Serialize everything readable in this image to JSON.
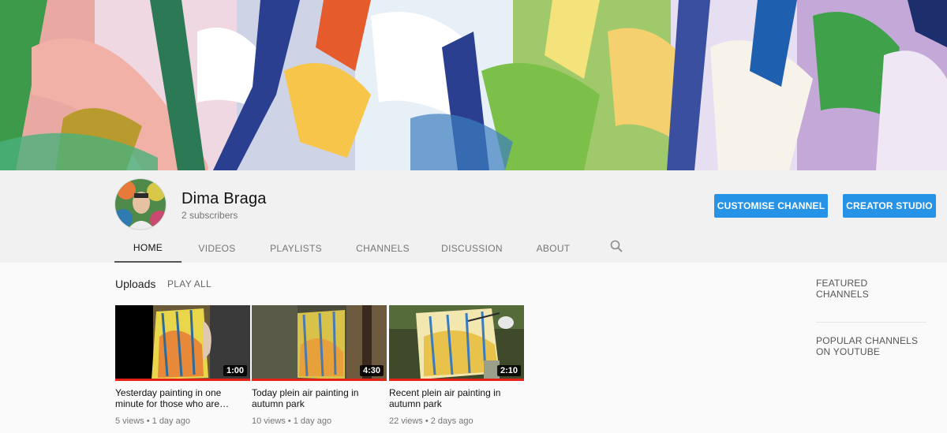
{
  "channel": {
    "name": "Dima Braga",
    "subscribers": "2 subscribers"
  },
  "actions": {
    "customise": "CUSTOMISE CHANNEL",
    "studio": "CREATOR STUDIO"
  },
  "tabs": [
    {
      "label": "HOME",
      "active": true
    },
    {
      "label": "VIDEOS",
      "active": false
    },
    {
      "label": "PLAYLISTS",
      "active": false
    },
    {
      "label": "CHANNELS",
      "active": false
    },
    {
      "label": "DISCUSSION",
      "active": false
    },
    {
      "label": "ABOUT",
      "active": false
    }
  ],
  "search_icon": "search-icon",
  "uploads": {
    "title": "Uploads",
    "play_all": "PLAY ALL",
    "videos": [
      {
        "title": "Yesterday painting in one minute for those who are…",
        "duration": "1:00",
        "meta": "5 views • 1 day ago"
      },
      {
        "title": "Today plein air painting in autumn park",
        "duration": "4:30",
        "meta": "10 views • 1 day ago"
      },
      {
        "title": "Recent plein air painting in autumn park",
        "duration": "2:10",
        "meta": "22 views • 2 days ago"
      }
    ]
  },
  "sidebar": {
    "featured": "FEATURED CHANNELS",
    "popular": "POPULAR CHANNELS ON YOUTUBE"
  },
  "colors": {
    "accent_button": "#2793e6",
    "progress_red": "#e62117"
  }
}
